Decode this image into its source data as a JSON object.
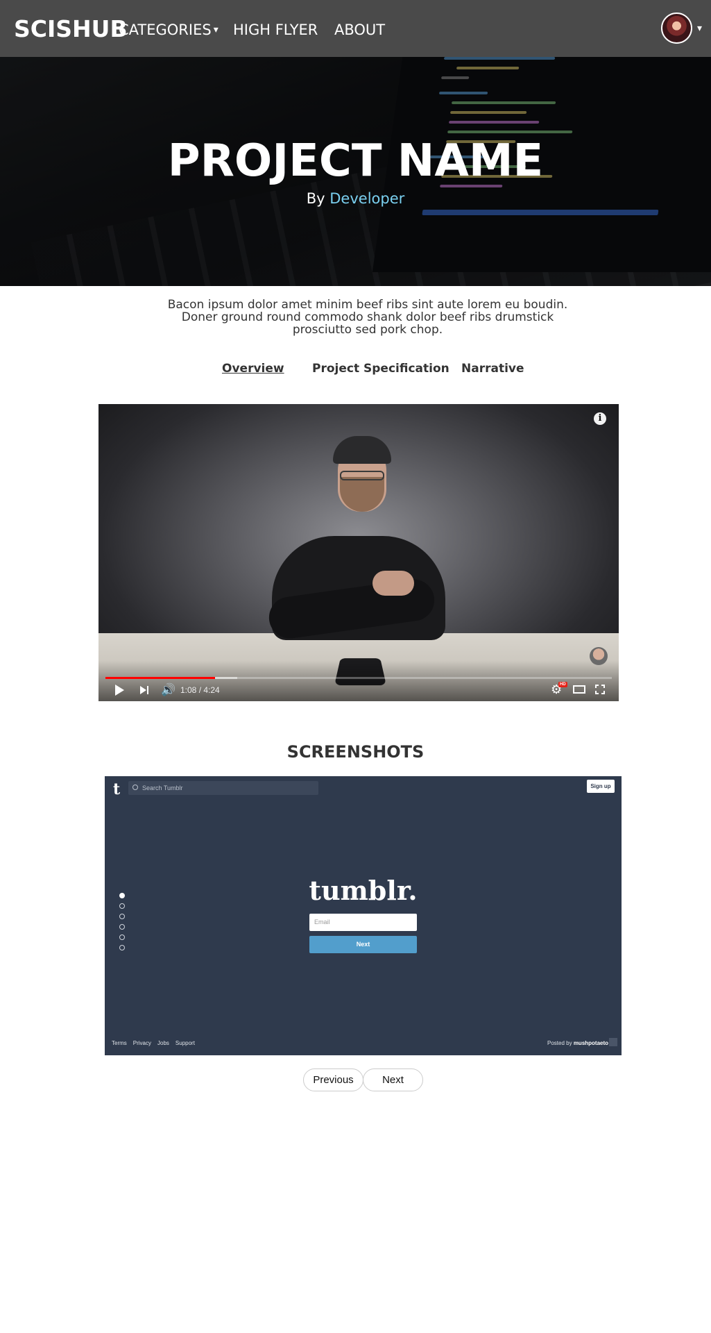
{
  "navbar": {
    "brand": "SCISHUB",
    "categories": "CATEGORIES",
    "categories_caret": "▾",
    "high_flyer": "HIGH FLYER",
    "about": "ABOUT",
    "avatar_caret": "▾"
  },
  "hero": {
    "title": "PROJECT NAME",
    "by": "By",
    "developer": "Developer"
  },
  "description": "Bacon ipsum dolor amet minim beef ribs sint aute lorem eu boudin. Doner ground round commodo shank dolor beef ribs drumstick prosciutto sed pork chop.",
  "tabs": {
    "overview": "Overview",
    "spec": "Project Specification",
    "narrative": "Narrative"
  },
  "video": {
    "time": "1:08 / 4:24",
    "played_fraction": 0.217,
    "buffered_fraction": 0.26,
    "info_glyph": "i",
    "hd_badge": "HD",
    "volume_glyph": "🔊",
    "settings_glyph": "⚙"
  },
  "screenshots": {
    "title": "SCREENSHOTS",
    "app": {
      "t_logo": "t",
      "search_placeholder": "Search Tumblr",
      "signup": "Sign up",
      "wordmark": "tumblr.",
      "email_placeholder": "Email",
      "next": "Next",
      "footer_links": [
        "Terms",
        "Privacy",
        "Jobs",
        "Support"
      ],
      "posted_by": "Posted by",
      "posted_user": "mushpotaeto"
    }
  },
  "pager": {
    "previous": "Previous",
    "next": "Next"
  },
  "colors": {
    "navbar": "#4a4a4a",
    "developer_link": "#7ad0f0",
    "progress_played": "#ff0000",
    "tumblr_bg": "#2f3a4d",
    "tumblr_button": "#529ecc"
  },
  "icons": [
    "categories-caret-icon",
    "avatar-caret-icon",
    "info-icon",
    "play-icon",
    "next-track-icon",
    "volume-icon",
    "settings-icon",
    "theater-mode-icon",
    "fullscreen-icon",
    "tumblr-t-icon",
    "search-icon"
  ]
}
